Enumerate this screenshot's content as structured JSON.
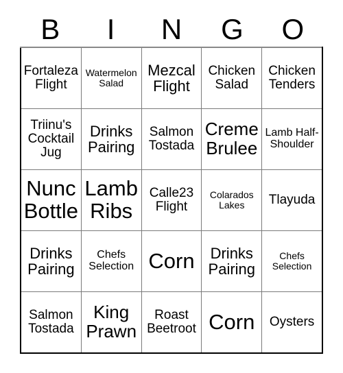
{
  "card": {
    "title": "BINGO",
    "header_letters": [
      "B",
      "I",
      "N",
      "G",
      "O"
    ],
    "colors": {
      "text": "#000000",
      "grid_line": "#7a7a7a",
      "outer_border": "#000000",
      "top_border": "#888888",
      "background": "#ffffff"
    },
    "grid": {
      "columns": 5,
      "rows": 5,
      "cells": [
        [
          {
            "label": "Fortaleza Flight",
            "size": "m"
          },
          {
            "label": "Watermelon Salad",
            "size": "xs"
          },
          {
            "label": "Mezcal Flight",
            "size": "l"
          },
          {
            "label": "Chicken Salad",
            "size": "m"
          },
          {
            "label": "Chicken Tenders",
            "size": "m"
          }
        ],
        [
          {
            "label": "Triinu's Cocktail Jug",
            "size": "m"
          },
          {
            "label": "Drinks Pairing",
            "size": "l"
          },
          {
            "label": "Salmon Tostada",
            "size": "m"
          },
          {
            "label": "Creme Brulee",
            "size": "xl"
          },
          {
            "label": "Lamb Half-Shoulder",
            "size": "s"
          }
        ],
        [
          {
            "label": "Nunc Bottle",
            "size": "xxl"
          },
          {
            "label": "Lamb Ribs",
            "size": "xxl"
          },
          {
            "label": "Calle23 Flight",
            "size": "m"
          },
          {
            "label": "Colarados Lakes",
            "size": "xs"
          },
          {
            "label": "Tlayuda",
            "size": "m"
          }
        ],
        [
          {
            "label": "Drinks Pairing",
            "size": "l"
          },
          {
            "label": "Chefs Selection",
            "size": "s"
          },
          {
            "label": "Corn",
            "size": "xxl"
          },
          {
            "label": "Drinks Pairing",
            "size": "l"
          },
          {
            "label": "Chefs Selection",
            "size": "xs"
          }
        ],
        [
          {
            "label": "Salmon Tostada",
            "size": "m"
          },
          {
            "label": "King Prawn",
            "size": "xl"
          },
          {
            "label": "Roast Beetroot",
            "size": "m"
          },
          {
            "label": "Corn",
            "size": "xxl"
          },
          {
            "label": "Oysters",
            "size": "m"
          }
        ]
      ]
    }
  }
}
